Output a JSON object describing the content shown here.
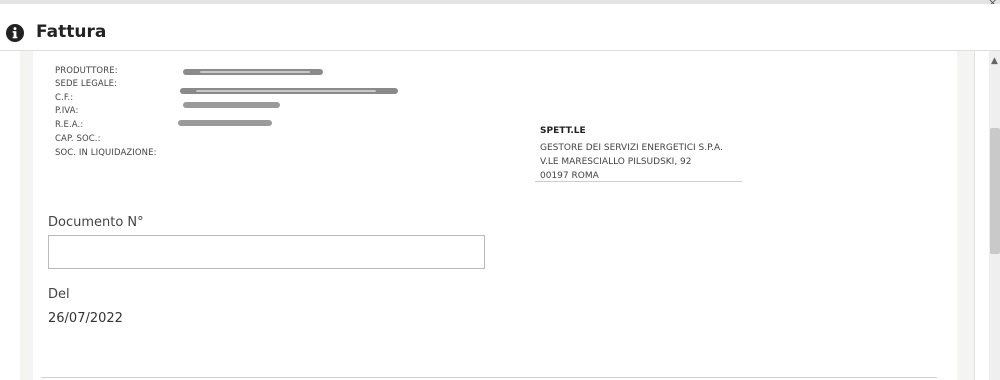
{
  "window": {
    "title": "Fattura",
    "close_glyph": "×",
    "scroll_up_glyph": "▲"
  },
  "producer": {
    "labels": [
      "PRODUTTORE:",
      "SEDE LEGALE:",
      "C.F.:",
      "P.IVA:",
      "R.E.A.:",
      "CAP. SOC.:",
      "SOC. IN LIQUIDAZIONE:"
    ]
  },
  "recipient": {
    "heading": "SPETT.LE",
    "name": "GESTORE DEI SERVIZI ENERGETICI S.P.A.",
    "street": "V.LE MARESCIALLO PILSUDSKI, 92",
    "city": "00197 ROMA"
  },
  "form": {
    "document_label": "Documento N°",
    "document_value": "",
    "date_label": "Del",
    "date_value": "26/07/2022"
  },
  "icons": {
    "header": "info-circle-icon"
  }
}
